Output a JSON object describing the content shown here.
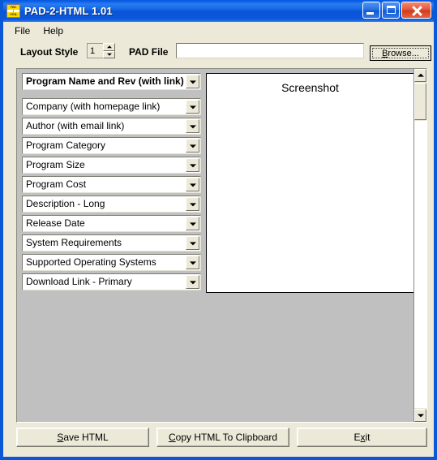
{
  "window": {
    "title": "PAD-2-HTML 1.01",
    "icon_name": "pad-2-html-app-icon",
    "icon_top_text": "PAD",
    "icon_mid_text": "↓",
    "icon_bottom_text": "HTML",
    "accent_color": "#0a58d6",
    "face_color": "#ece9d8",
    "panel_color": "#c0c0c0",
    "controls": {
      "minimize": "Minimize",
      "maximize": "Maximize",
      "close": "Close"
    }
  },
  "menu": {
    "items": [
      {
        "label": "File"
      },
      {
        "label": "Help"
      }
    ]
  },
  "toolbar": {
    "layout_style_label": "Layout Style",
    "layout_style_value": "1",
    "spin_up_label": "Increase layout style",
    "spin_down_label": "Decrease layout style",
    "pad_file_label": "PAD File",
    "pad_file_value": "",
    "pad_file_placeholder": "",
    "browse_label": "Browse..."
  },
  "main": {
    "screenshot_label": "Screenshot",
    "fields": [
      {
        "label": "Program Name and Rev (with link)",
        "bold": true
      },
      {
        "label": "Company (with homepage link)",
        "bold": false
      },
      {
        "label": "Author (with email link)",
        "bold": false
      },
      {
        "label": "Program Category",
        "bold": false
      },
      {
        "label": "Program Size",
        "bold": false
      },
      {
        "label": "Program Cost",
        "bold": false
      },
      {
        "label": "Description - Long",
        "bold": false
      },
      {
        "label": "Release Date",
        "bold": false
      },
      {
        "label": "System Requirements",
        "bold": false
      },
      {
        "label": "Supported Operating Systems",
        "bold": false
      },
      {
        "label": "Download Link - Primary",
        "bold": false
      }
    ]
  },
  "scrollbar": {
    "up_label": "Scroll up",
    "down_label": "Scroll down",
    "thumb_label": "Scroll thumb"
  },
  "buttons": {
    "save_html": "Save HTML",
    "copy_clipboard": "Copy HTML To Clipboard",
    "exit": "Exit"
  }
}
